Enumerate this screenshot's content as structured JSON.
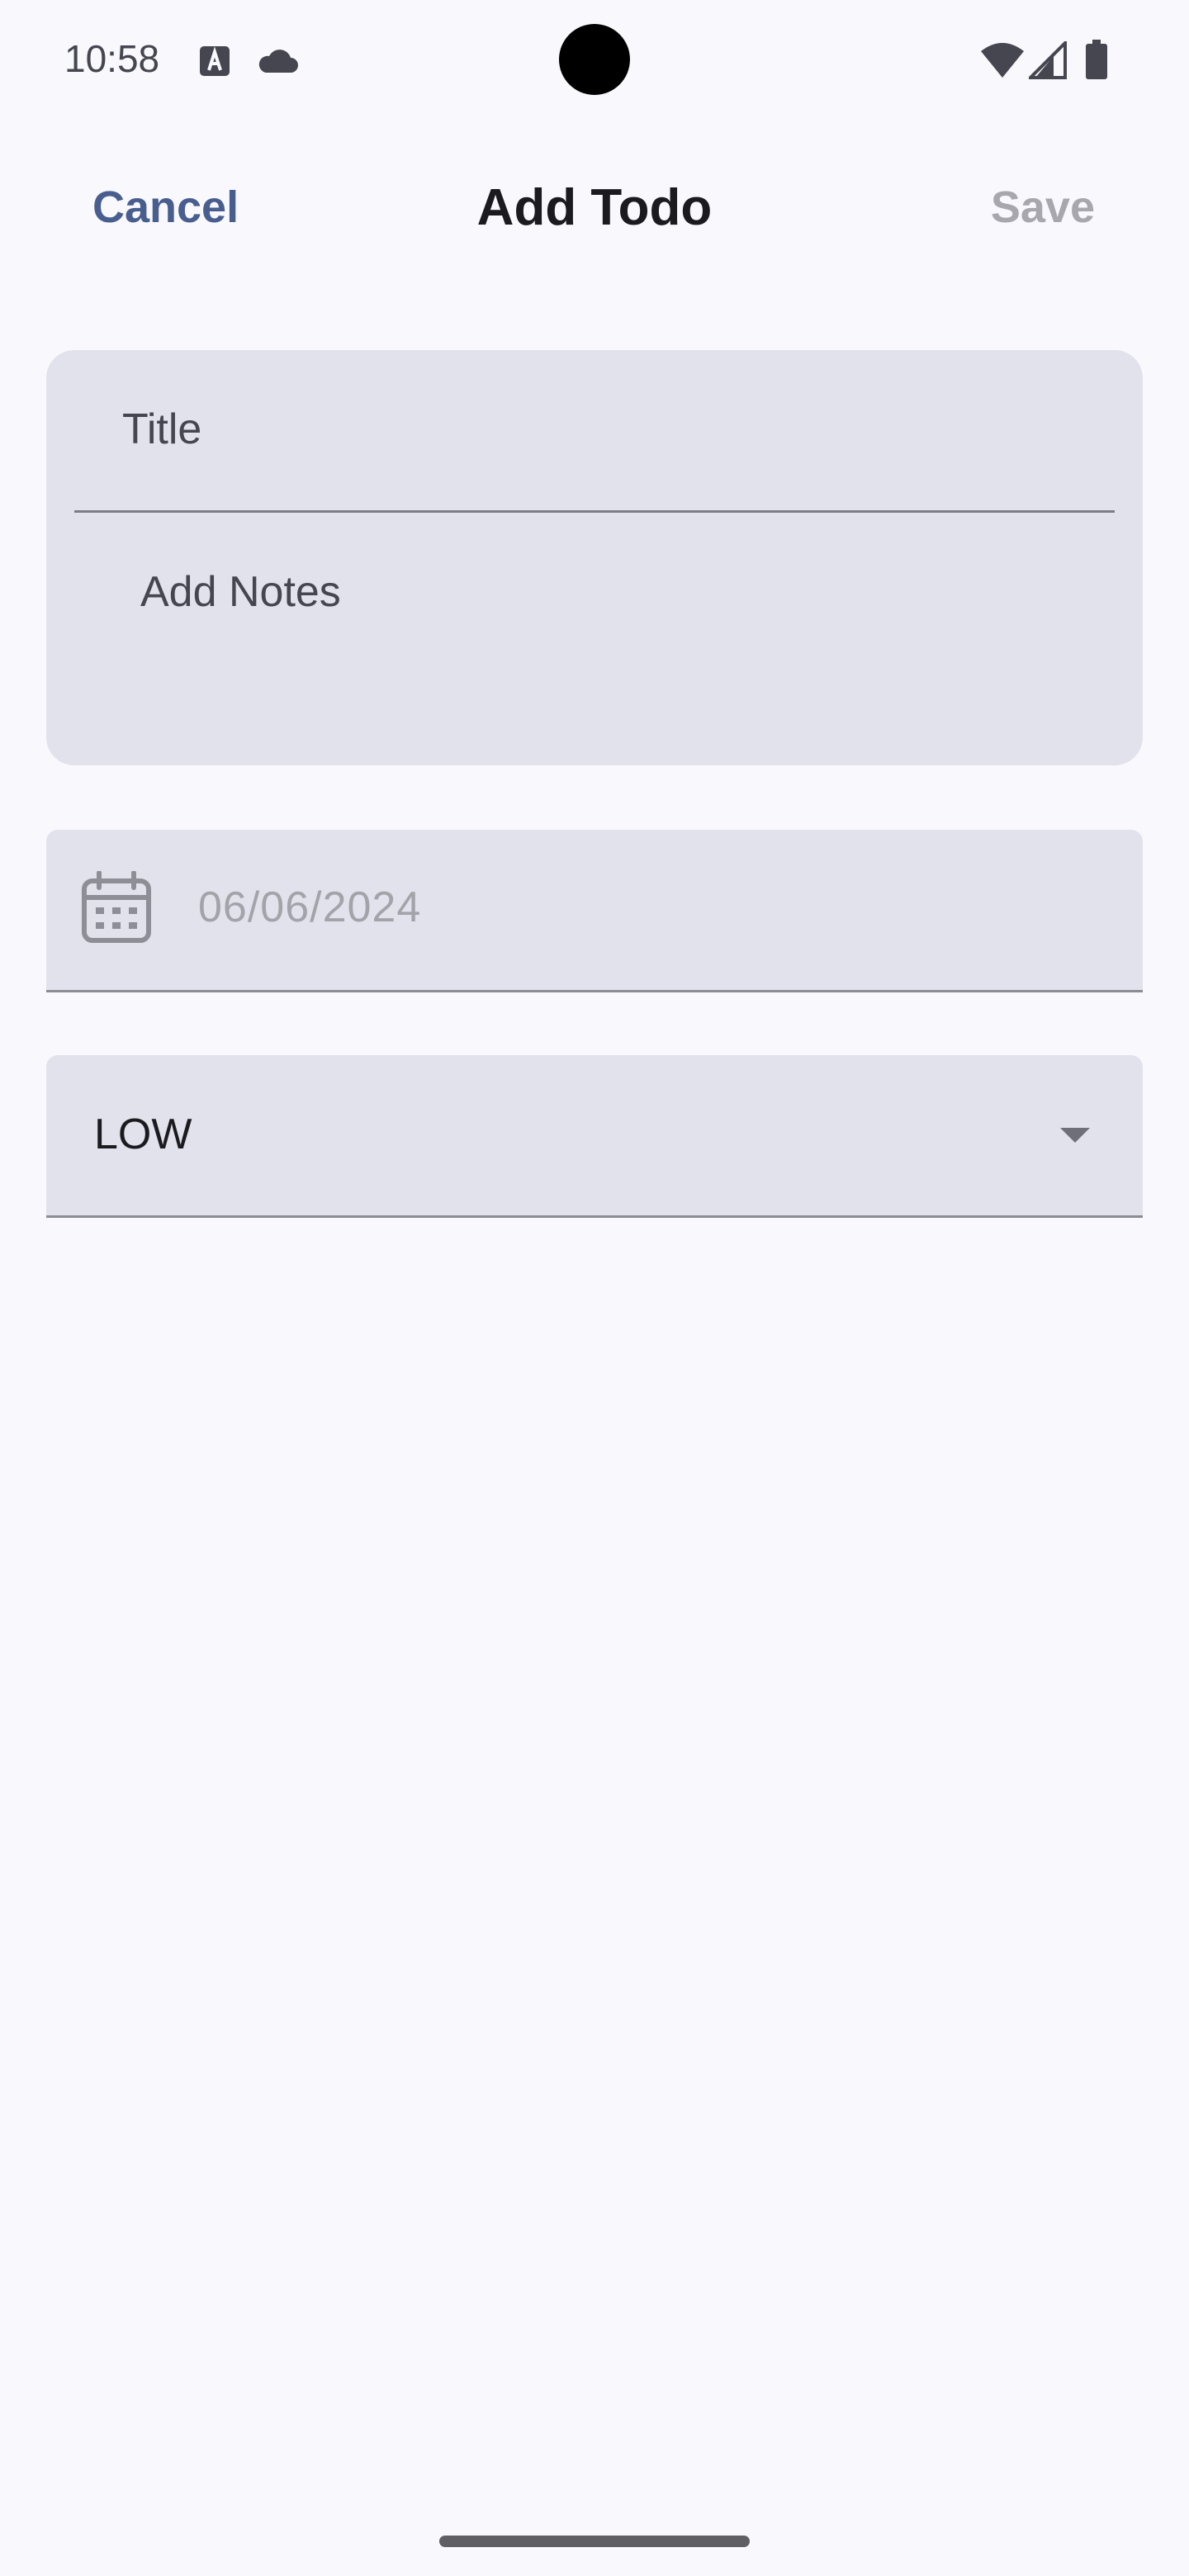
{
  "status_bar": {
    "time": "10:58",
    "icons": [
      "keyboard-a-icon",
      "cloud-icon",
      "wifi-icon",
      "signal-icon",
      "battery-icon"
    ]
  },
  "top_bar": {
    "cancel_label": "Cancel",
    "title": "Add Todo",
    "save_label": "Save"
  },
  "form": {
    "title_placeholder": "Title",
    "notes_placeholder": "Add Notes",
    "date_value": "06/06/2024",
    "priority_value": "LOW"
  },
  "colors": {
    "background": "#f9f8fd",
    "field_background": "#e1e2ec",
    "accent": "#485e8f",
    "disabled_text": "#a7a7ad"
  }
}
